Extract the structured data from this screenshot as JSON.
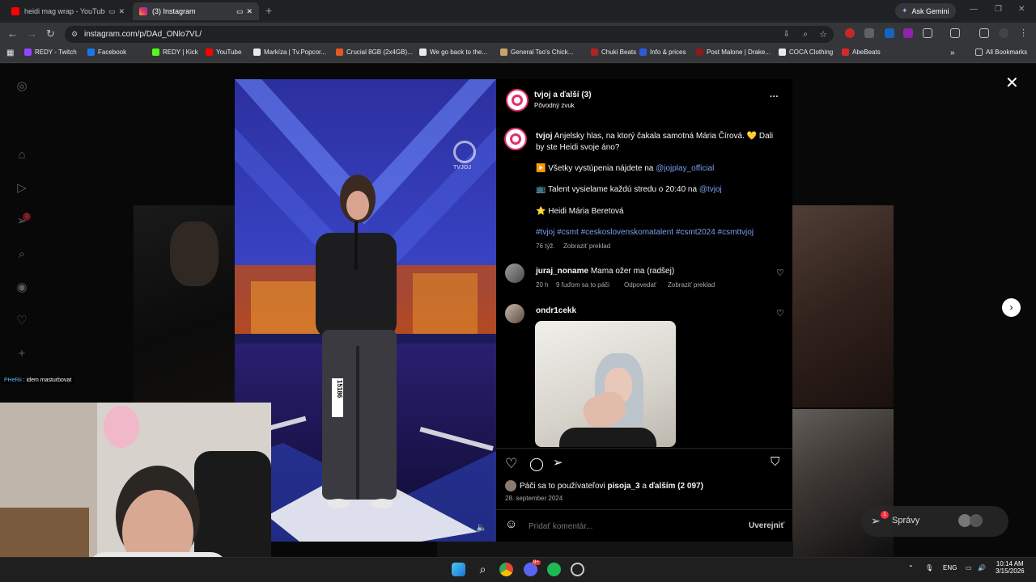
{
  "browser": {
    "tabs": [
      {
        "title": "heidi mag wrap - YouTube",
        "color": "#ff0000"
      },
      {
        "title": "(3) Instagram",
        "color": "#e1306c"
      }
    ],
    "new_tab": "+",
    "ask_gemini": "Ask Gemini",
    "url": "instagram.com/p/DAd_ONlo7VL/",
    "bookmarks": [
      {
        "label": "REDY - Twitch",
        "color": "#9146ff"
      },
      {
        "label": "Facebook",
        "color": "#1877f2"
      },
      {
        "label": "REDY | Kick",
        "color": "#53fc18"
      },
      {
        "label": "YouTube",
        "color": "#ff0000"
      },
      {
        "label": "Markíza | Tv.Popcor...",
        "color": "#e8eaed"
      },
      {
        "label": "Crucial 8GB (2x4GB)...",
        "color": "#e25822"
      },
      {
        "label": "We go back to the...",
        "color": "#e8eaed"
      },
      {
        "label": "General Tso's Chick...",
        "color": "#c9a46a"
      },
      {
        "label": "Chuki Beats",
        "color": "#b22222"
      },
      {
        "label": "Info & prices",
        "color": "#2b5cd6"
      },
      {
        "label": "Post Malone | Drake...",
        "color": "#8b1a1a"
      },
      {
        "label": "COCA Clothing",
        "color": "#e8eaed"
      },
      {
        "label": "AbeBeats",
        "color": "#d62828"
      }
    ],
    "all_bookmarks": "All Bookmarks"
  },
  "post": {
    "header_user": "tvjoj a ďalší (3)",
    "header_audio": "Pôvodný zvuk",
    "more": "···",
    "caption": {
      "user": "tvjoj",
      "text1": " Anjelsky hlas, na ktorý čakala samotná Mária Čírová. 💛 Dali",
      "text2": "by ste Heidi svoje áno?",
      "line_a_pre": "▶️ Všetky vystúpenia nájdete na ",
      "line_a_link": "@jojplay_official",
      "line_b_pre": "📺 Talent vysielame každú stredu o 20:40 na ",
      "line_b_link": "@tvjoj",
      "line_c": "⭐ Heidi Mária Beretová",
      "hashtags": "#tvjoj #csmt #ceskoslovenskomatalent #csmt2024 #csmttvjoj",
      "time": "76 týž.",
      "translate": "Zobraziť preklad"
    },
    "comments": [
      {
        "user": "juraj_noname",
        "text": "Mama ožer ma (radšej)",
        "time": "20 h",
        "likes": "9 ľuďom sa to páči",
        "reply": "Odpovedať",
        "translate": "Zobraziť preklad"
      },
      {
        "user": "ondr1cekk"
      }
    ],
    "liked_by_pre": "Páči sa to používateľovi ",
    "liked_by_user": "pisoja_3",
    "liked_by_mid": " a ",
    "liked_by_rest": "ďalším (2 097)",
    "date": "28. september 2024",
    "comment_placeholder": "Pridať komentár...",
    "publish": "Uverejniť",
    "video_number": "15186",
    "watermark": "TVJOJ"
  },
  "overlay": {
    "chat_user": "PHeRii",
    "chat_text": " : idem masturbovat",
    "spravy": "Správy",
    "notif_badge": "1"
  },
  "taskbar": {
    "lang": "ENG",
    "time": "10:14 AM",
    "date": "3/15/2026",
    "discord_badge": "9+"
  }
}
